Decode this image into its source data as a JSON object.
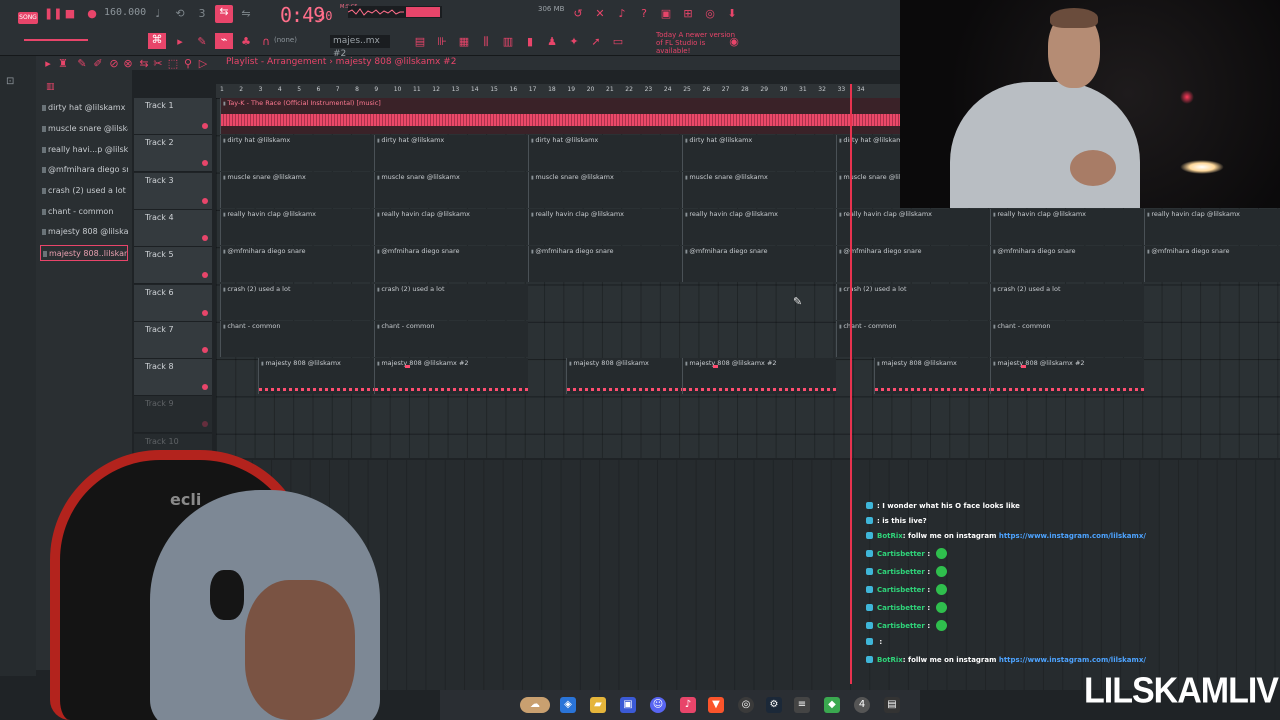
{
  "toolbar": {
    "song_label": "SONG",
    "tempo": "160.000",
    "time": "0:49",
    "time_sub": "30",
    "time_unit": "M:S:CS",
    "cpu_ram": "306 MB",
    "pattern": "majes..mx #2",
    "none_label": "(none)",
    "update_note": "Today A newer version of FL Studio is available!"
  },
  "playlist": {
    "title": "Playlist - Arrangement  › majesty 808 @lilskamx #2",
    "ruler_marks": [
      "1",
      "2",
      "3",
      "4",
      "5",
      "6",
      "7",
      "8",
      "9",
      "10",
      "11",
      "12",
      "13",
      "14",
      "15",
      "16",
      "17",
      "18",
      "19",
      "20",
      "21",
      "22",
      "23",
      "24",
      "25",
      "26",
      "27",
      "28",
      "29",
      "30",
      "31",
      "32",
      "33",
      "34"
    ],
    "tracks": [
      "Track 1",
      "Track 2",
      "Track 3",
      "Track 4",
      "Track 5",
      "Track 6",
      "Track 7",
      "Track 8",
      "Track 9",
      "Track 10"
    ]
  },
  "picker": [
    "dirty hat @lilskamx",
    "muscle snare @lilskamx",
    "really havi...p @lilskamx",
    "@mfmihara diego snare",
    "crash (2) used a lot",
    "chant - common",
    "majesty 808 @lilskamx",
    "majesty 808..lilskamx #2"
  ],
  "clips": {
    "audio_label": "Tay-K - The Race (Official Instrumental) [music]",
    "dirty_hat": "dirty hat @lilskamx",
    "muscle_snare": "muscle snare @lilskamx",
    "clap": "really havin clap @lilskamx",
    "diego": "@mfmihara diego snare",
    "crash": "crash (2) used a lot",
    "chant": "chant - common",
    "majesty1": "majesty 808 @lilskamx",
    "majesty2": "majesty 808 @lilskamx #2"
  },
  "chat": [
    {
      "user": "",
      "msg": ": I wonder what his O face looks like"
    },
    {
      "user": "",
      "msg": ": is this live?"
    },
    {
      "user": "BotRix",
      "msg": ": follw me on instagram ",
      "link": "https://www.instagram.com/lilskamx/"
    },
    {
      "user": "Cartisbetter",
      "msg": " :"
    },
    {
      "user": "Cartisbetter",
      "msg": " :"
    },
    {
      "user": "Cartisbetter",
      "msg": " :"
    },
    {
      "user": "Cartisbetter",
      "msg": " :"
    },
    {
      "user": "Cartisbetter",
      "msg": " :"
    },
    {
      "user": "",
      "msg": " :"
    },
    {
      "user": "BotRix",
      "msg": ": follw me on instagram ",
      "link": "https://www.instagram.com/lilskamx/"
    }
  ],
  "chair_logo": "ecli",
  "brand": "LILSKAMLIVE",
  "colors": {
    "accent": "#e8456a",
    "background": "#2b3134",
    "chat_user": "#2fd57a",
    "link": "#4da3ff"
  }
}
